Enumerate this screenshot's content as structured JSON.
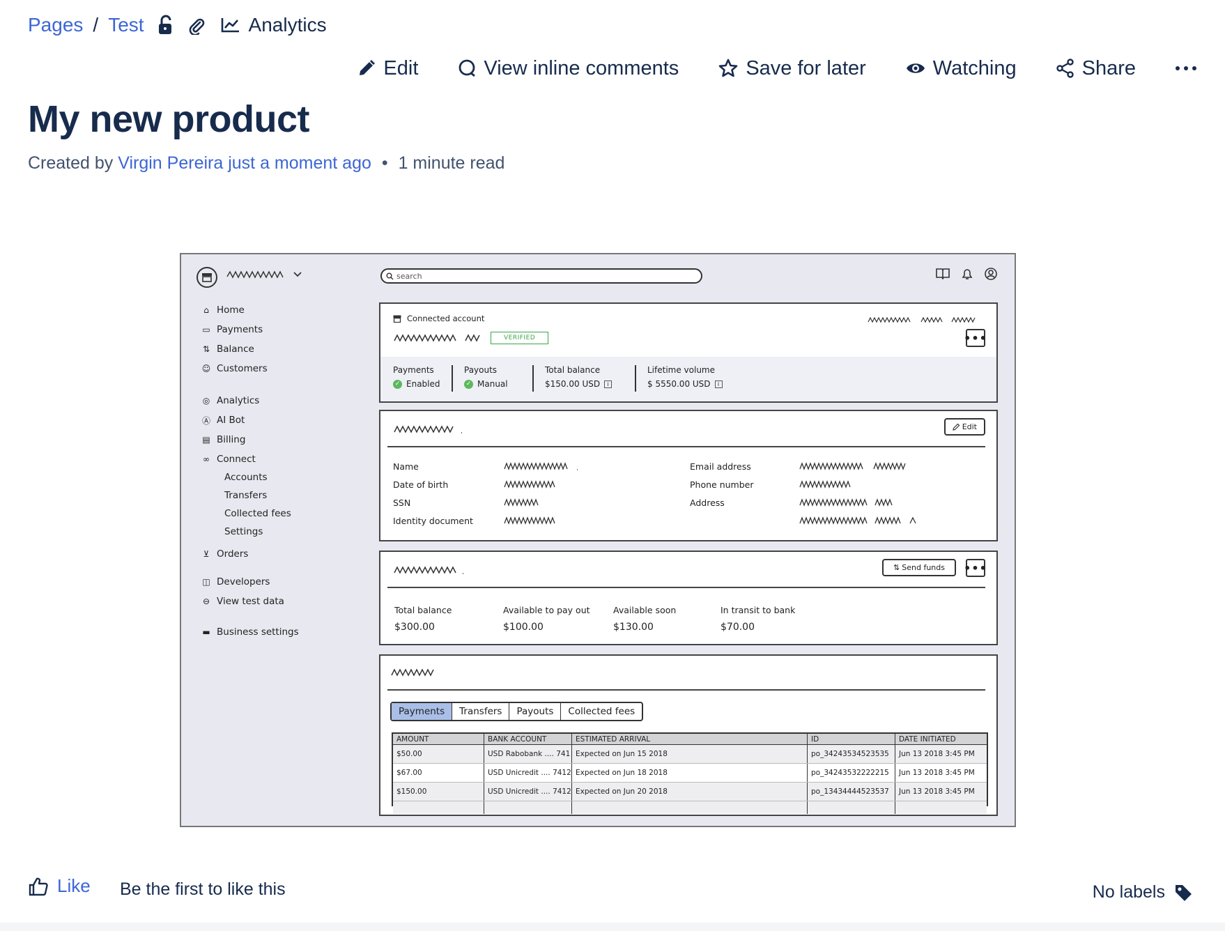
{
  "breadcrumb": {
    "items": [
      "Pages",
      "Test"
    ],
    "separator": "/",
    "analytics_label": "Analytics"
  },
  "toolbar": {
    "edit": "Edit",
    "view_comments": "View inline comments",
    "save_later": "Save for later",
    "watching": "Watching",
    "share": "Share",
    "more": "•••"
  },
  "page": {
    "title": "My new product",
    "byline_prefix": "Created by",
    "author": "Virgin Pereira",
    "time": "just a moment ago",
    "read_time": "1 minute read"
  },
  "wireframe": {
    "search_placeholder": "search",
    "nav": {
      "home": "Home",
      "payments": "Payments",
      "balance": "Balance",
      "customers": "Customers",
      "analytics": "Analytics",
      "ai_bot": "AI Bot",
      "billing": "Billing",
      "connect": "Connect",
      "accounts": "Accounts",
      "transfers": "Transfers",
      "collected_fees": "Collected fees",
      "settings": "Settings",
      "orders": "Orders",
      "developers": "Developers",
      "view_test_data": "View test data",
      "business_settings": "Business settings"
    },
    "account_card": {
      "label": "Connected account",
      "badge": "VERIFIED",
      "stats": [
        {
          "label": "Payments",
          "value": "Enabled"
        },
        {
          "label": "Payouts",
          "value": "Manual"
        },
        {
          "label": "Total balance",
          "value": "$150.00 USD"
        },
        {
          "label": "Lifetime volume",
          "value": "$ 5550.00 USD"
        }
      ]
    },
    "profile_card": {
      "edit": "Edit",
      "fields_left": [
        "Name",
        "Date of birth",
        "SSN",
        "Identity document"
      ],
      "fields_right": [
        "Email address",
        "Phone number",
        "Address"
      ]
    },
    "balance_card": {
      "send_funds": "Send funds",
      "items": [
        {
          "label": "Total balance",
          "value": "$300.00"
        },
        {
          "label": "Available to pay out",
          "value": "$100.00"
        },
        {
          "label": "Available soon",
          "value": "$130.00"
        },
        {
          "label": "In transit to bank",
          "value": "$70.00"
        }
      ]
    },
    "table_card": {
      "tabs": [
        "Payments",
        "Transfers",
        "Payouts",
        "Collected fees"
      ],
      "columns": [
        "AMOUNT",
        "BANK ACCOUNT",
        "ESTIMATED ARRIVAL",
        "ID",
        "DATE INITIATED"
      ],
      "rows": [
        [
          "$50.00",
          "USD Rabobank .... 741",
          "Expected on Jun 15 2018",
          "po_34243534523535",
          "Jun 13 2018 3:45 PM"
        ],
        [
          "$67.00",
          "USD Unicredit .... 7412",
          "Expected on Jun 18 2018",
          "po_34243532222215",
          "Jun 13 2018 3:45 PM"
        ],
        [
          "$150.00",
          "USD Unicredit .... 7412",
          "Expected on Jun 20 2018",
          "po_13434444523537",
          "Jun 13 2018 3:45 PM"
        ]
      ]
    }
  },
  "footer": {
    "like": "Like",
    "like_note": "Be the first to like this",
    "no_labels": "No labels"
  },
  "colors": {
    "link": "#3c66d6",
    "text": "#172b4d",
    "verified": "#3aa548",
    "active_tab": "#a9bfe8"
  }
}
